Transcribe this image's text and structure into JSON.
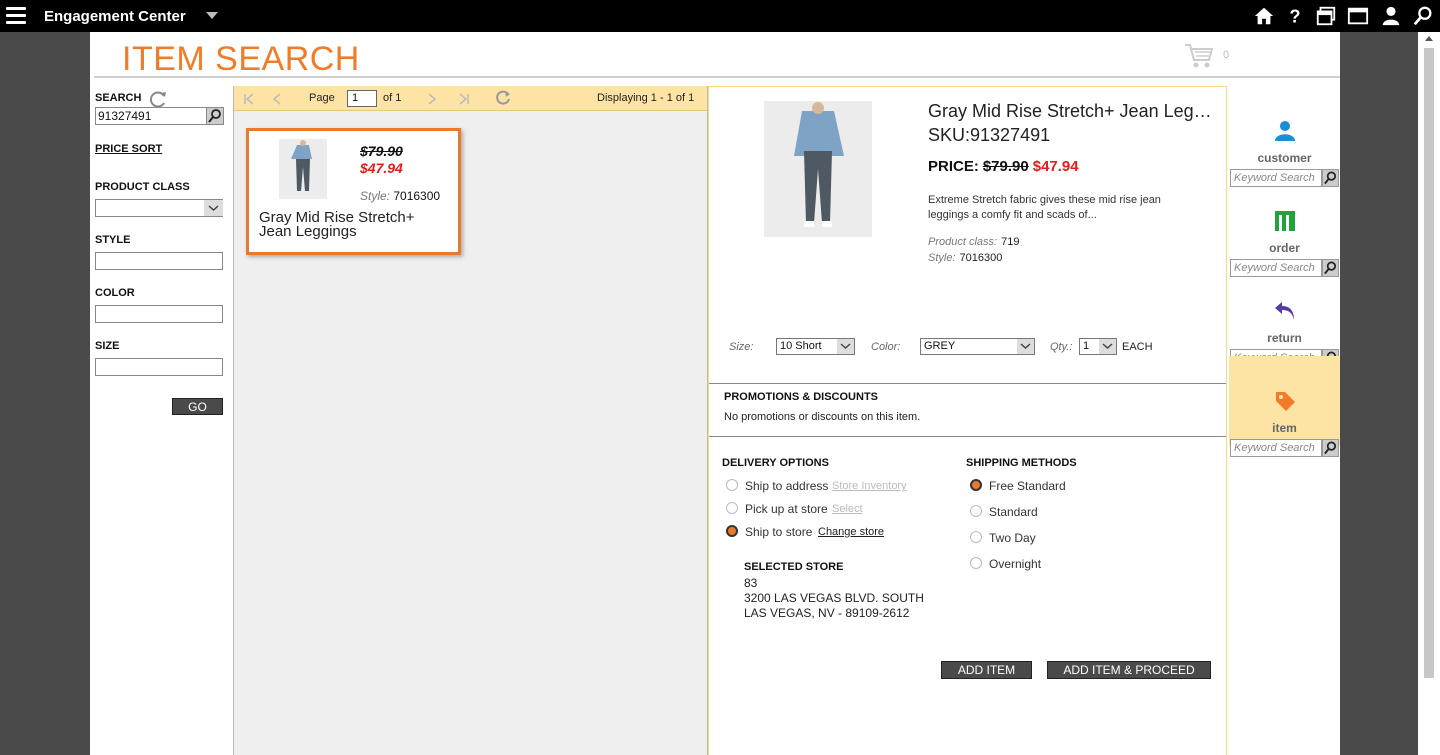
{
  "app": {
    "title": "Engagement Center"
  },
  "page": {
    "title": "ITEM SEARCH",
    "cart_count": "0"
  },
  "search_panel": {
    "search_label": "SEARCH",
    "search_value": "91327491",
    "price_sort": "PRICE SORT",
    "product_class_label": "PRODUCT CLASS",
    "product_class_value": "",
    "style_label": "STYLE",
    "color_label": "COLOR",
    "size_label": "SIZE",
    "go_label": "GO"
  },
  "pager": {
    "page_label": "Page",
    "page_value": "1",
    "of_label": "of 1",
    "displaying": "Displaying 1 - 1 of 1"
  },
  "result_card": {
    "old_price": "$79.90",
    "new_price": "$47.94",
    "style_label": "Style:",
    "style_value": "7016300",
    "name": "Gray Mid Rise Stretch+ Jean Leggings"
  },
  "detail": {
    "name": "Gray Mid Rise Stretch+ Jean Leggings",
    "sku": "SKU:91327491",
    "price_label": "PRICE:",
    "old_price": "$79.90",
    "new_price": "$47.94",
    "description": "Extreme Stretch fabric gives these mid rise jean leggings a comfy fit and scads of...",
    "product_class_label": "Product class:",
    "product_class_value": "719",
    "style_label": "Style:",
    "style_value": "7016300",
    "size_label": "Size:",
    "size_value": "10 Short",
    "color_label": "Color:",
    "color_value": "GREY",
    "qty_label": "Qty.:",
    "qty_value": "1",
    "qty_unit": "EACH"
  },
  "promotions": {
    "heading": "PROMOTIONS & DISCOUNTS",
    "text": "No promotions or discounts on this item."
  },
  "delivery": {
    "heading": "DELIVERY OPTIONS",
    "options": [
      {
        "label": "Ship to address",
        "link": "Store Inventory",
        "selected": false
      },
      {
        "label": "Pick up at store",
        "link": "Select",
        "selected": false
      },
      {
        "label": "Ship to store",
        "link": "Change store",
        "selected": true
      }
    ],
    "selected_store_heading": "SELECTED STORE",
    "store_number": "83",
    "store_address": "3200 LAS VEGAS BLVD. SOUTH",
    "store_city": "LAS VEGAS, NV - 89109-2612"
  },
  "shipping": {
    "heading": "SHIPPING METHODS",
    "methods": [
      {
        "label": "Free Standard",
        "selected": true
      },
      {
        "label": "Standard",
        "selected": false
      },
      {
        "label": "Two Day",
        "selected": false
      },
      {
        "label": "Overnight",
        "selected": false
      }
    ]
  },
  "actions": {
    "add_item": "ADD ITEM",
    "add_proceed": "ADD ITEM & PROCEED"
  },
  "right_nav": {
    "items": [
      {
        "label": "customer",
        "placeholder": "Keyword Search",
        "active": false
      },
      {
        "label": "order",
        "placeholder": "Keyword Search",
        "active": false
      },
      {
        "label": "return",
        "placeholder": "Keyword Search",
        "active": false
      },
      {
        "label": "item",
        "placeholder": "Keyword Search",
        "active": true
      }
    ]
  },
  "colors": {
    "accent": "#f07c2a",
    "sale_red": "#e31c1c",
    "highlight": "#fde4a4",
    "nav_blue": "#1b8fd6",
    "nav_green": "#1fa33a",
    "nav_purple": "#5a3aa3"
  }
}
